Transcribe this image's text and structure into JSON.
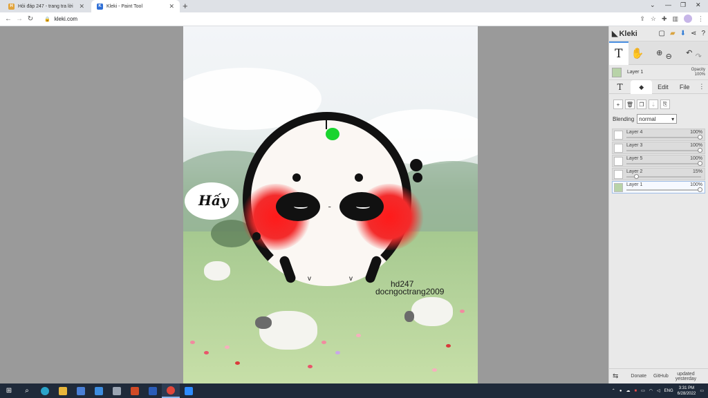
{
  "browser": {
    "tabs": [
      {
        "title": "Hỏi đáp 247 - trang tra lời",
        "active": false
      },
      {
        "title": "Kleki - Paint Tool",
        "active": true
      }
    ],
    "url": "kleki.com"
  },
  "artwork": {
    "bubble_text": "Hấy",
    "signature_line1": "hd247",
    "signature_line2": "docngoctrang2009"
  },
  "panel": {
    "logo": "Kleki",
    "current_layer": "Layer 1",
    "opacity_label": "Opacity",
    "opacity_value": "100%",
    "tabs": [
      "Edit",
      "File"
    ],
    "blending_label": "Blending",
    "blending_value": "normal",
    "layers": [
      {
        "name": "Layer 4",
        "opacity": "100%",
        "level": 1.0,
        "selected": false
      },
      {
        "name": "Layer 3",
        "opacity": "100%",
        "level": 1.0,
        "selected": false
      },
      {
        "name": "Layer 5",
        "opacity": "100%",
        "level": 1.0,
        "selected": false
      },
      {
        "name": "Layer 2",
        "opacity": "15%",
        "level": 0.15,
        "selected": false
      },
      {
        "name": "Layer 1",
        "opacity": "100%",
        "level": 1.0,
        "selected": true
      }
    ],
    "footer": {
      "donate": "Donate",
      "github": "GitHub",
      "updated_line1": "updated",
      "updated_line2": "yesterday"
    }
  },
  "taskbar": {
    "lang": "ENG",
    "time": "3:31 PM",
    "date": "6/28/2022"
  }
}
